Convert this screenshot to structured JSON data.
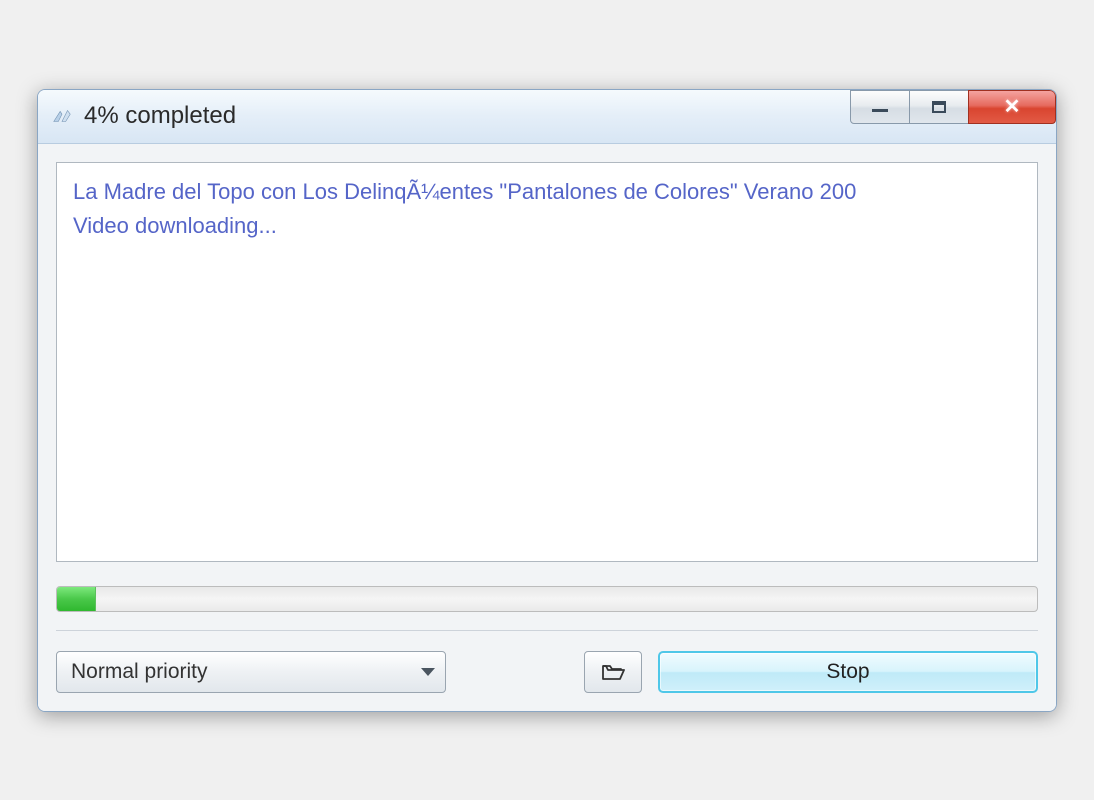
{
  "titlebar": {
    "title": "4% completed"
  },
  "log": {
    "line1": "La Madre del Topo con Los DelinqÃ¼entes \"Pantalones de Colores\" Verano 200",
    "line2": "Video downloading..."
  },
  "progress": {
    "percent": 4
  },
  "controls": {
    "priority_label": "Normal priority",
    "stop_label": "Stop"
  }
}
